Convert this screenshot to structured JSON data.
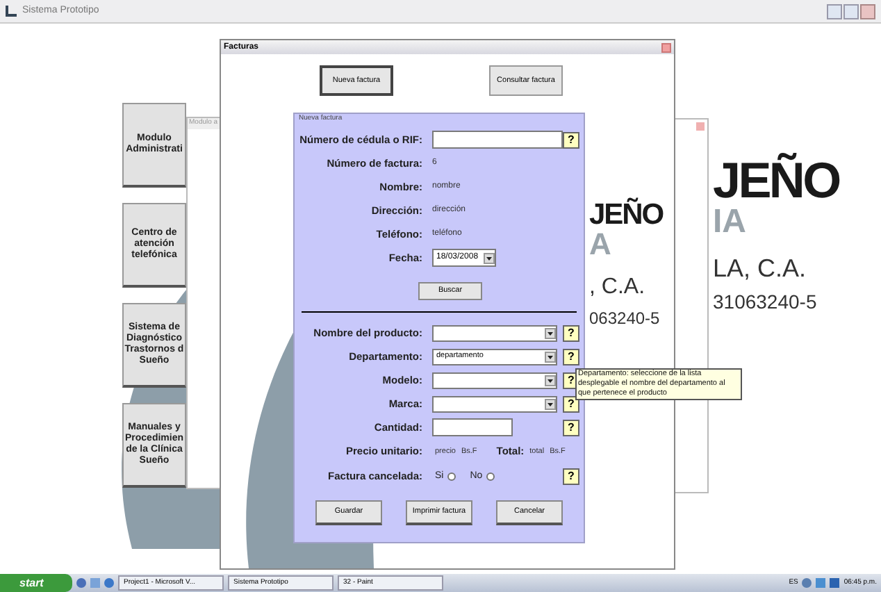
{
  "window": {
    "title": "Sistema Prototipo"
  },
  "menu_buttons": [
    {
      "label": "Modulo\nAdministrati"
    },
    {
      "label": "Centro de\natención\ntelefónica"
    },
    {
      "label": "Sistema de\nDiagnóstico\nTrastornos d\nSueño"
    },
    {
      "label": "Manuales y\nProcedimien\nde la Clínica\nSueño"
    }
  ],
  "back_window": {
    "title": "Modulo a"
  },
  "logo_texts": [
    {
      "kind": "big",
      "text": "JEÑO"
    },
    {
      "kind": "grey",
      "text": "IA"
    },
    {
      "kind": "mid",
      "text": "LA, C.A."
    },
    {
      "kind": "small",
      "text": "31063240-5"
    }
  ],
  "invoice_window": {
    "title": "Facturas",
    "top_buttons": [
      "Nueva factura",
      "Consultar factura"
    ],
    "logo_texts": [
      {
        "kind": "big",
        "text": "JEÑO"
      },
      {
        "kind": "grey",
        "text": "A"
      },
      {
        "kind": "mid",
        "text": ", C.A."
      },
      {
        "kind": "small",
        "text": "063240-5"
      }
    ],
    "form": {
      "legend": "Nueva factura",
      "lookup_rows": [
        {
          "kind": "input",
          "label": "Número de cédula o RIF:",
          "help": "?"
        },
        {
          "kind": "value",
          "label": "Número de factura:",
          "value": "6"
        },
        {
          "kind": "value",
          "label": "Nombre:",
          "value": "nombre"
        },
        {
          "kind": "value",
          "label": "Dirección:",
          "value": "dirección"
        },
        {
          "kind": "value",
          "label": "Teléfono:",
          "value": "teléfono"
        },
        {
          "kind": "date",
          "label": "Fecha:",
          "value": "18/03/2008"
        }
      ],
      "search_button": "Buscar",
      "product_rows": [
        {
          "kind": "combo",
          "label": "Nombre del producto:",
          "help": "?"
        },
        {
          "kind": "combo",
          "label": "Departamento:",
          "value": "departamento",
          "help": "?"
        },
        {
          "kind": "combo",
          "label": "Modelo:",
          "help": "?"
        },
        {
          "kind": "combo",
          "label": "Marca:",
          "help": "?"
        },
        {
          "kind": "input",
          "label": "Cantidad:",
          "help": "?"
        }
      ],
      "price_row": {
        "label": "Precio unitario:",
        "price": "precio",
        "currency": "Bs.F",
        "total_label": "Total:",
        "total": "total",
        "total_currency": "Bs.F"
      },
      "cancelled_row": {
        "label": "Factura cancelada:",
        "options": [
          {
            "label": "Si",
            "selected": false
          },
          {
            "label": "No",
            "selected": false
          }
        ],
        "help": "?"
      },
      "actions": [
        "Guardar",
        "Imprimir factura",
        "Cancelar"
      ]
    }
  },
  "tooltip": "Departamento: seleccione de la lista desplegable el nombre del departamento al que pertenece el producto",
  "taskbar": {
    "start": "start",
    "tasks": [
      "Project1 - Microsoft V...",
      "Sistema Prototipo",
      "32 - Paint"
    ],
    "language": "ES",
    "clock": "06:45 p.m."
  }
}
